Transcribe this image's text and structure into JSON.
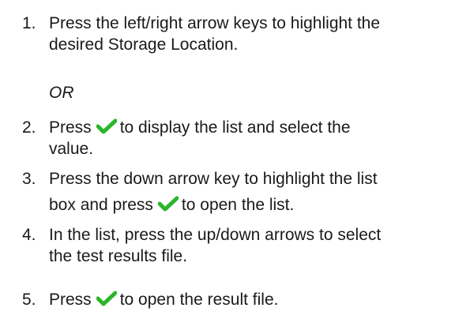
{
  "steps": [
    {
      "number": "1.",
      "lines": [
        "Press the left/right arrow keys to highlight the",
        "desired Storage Location."
      ]
    },
    {
      "separator": "OR"
    },
    {
      "number": "2.",
      "before": "Press",
      "after": "to display the list and select the",
      "line2": "value."
    },
    {
      "number": "3.",
      "line1": "Press the down arrow key to highlight the list",
      "before": "box and press",
      "after": "to open the list."
    },
    {
      "number": "4.",
      "lines": [
        "In the list, press the up/down arrows to select",
        "the test results file."
      ]
    },
    {
      "number": "5.",
      "before": "Press",
      "after": "to open the result file."
    }
  ],
  "icons": {
    "check": "check-icon",
    "check_color": "#2bb52b"
  }
}
